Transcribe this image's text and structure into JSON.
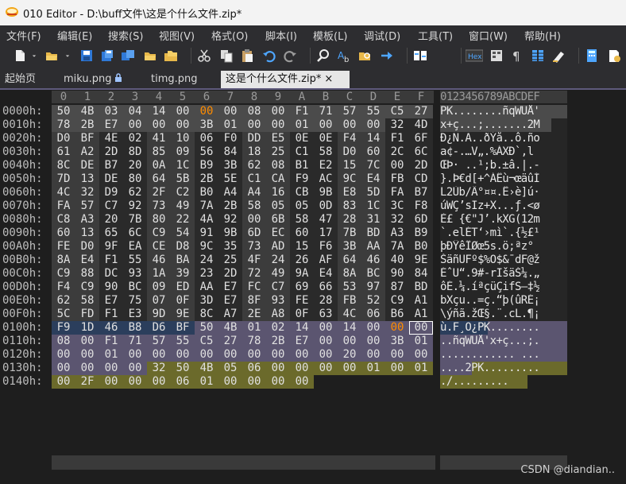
{
  "window": {
    "title": "010 Editor - D:\\buff文件\\这是个什么文件.zip*"
  },
  "menu": [
    "文件(F)",
    "编辑(E)",
    "搜索(S)",
    "视图(V)",
    "格式(O)",
    "脚本(I)",
    "模板(L)",
    "调试(D)",
    "工具(T)",
    "窗口(W)",
    "帮助(H)"
  ],
  "toolbar": {
    "icons": [
      "new-file-icon",
      "dropdown-icon",
      "open-folder-icon",
      "dropdown-icon",
      "save-icon",
      "save-as-icon",
      "save-all-icon",
      "open-folder-icon",
      "folder-group-icon",
      "cut-icon",
      "copy-icon",
      "paste-icon",
      "undo-icon",
      "redo-icon",
      "find-icon",
      "replace-icon",
      "find-in-files-icon",
      "goto-icon",
      "compare-icon",
      "hex-icon",
      "columns-icon",
      "paragraph-icon",
      "grid-icon",
      "highlight-icon",
      "calculator-icon",
      "template-icon"
    ],
    "hex_label": "Hex"
  },
  "tabs": [
    {
      "label": "起始页",
      "active": false,
      "locked": false
    },
    {
      "label": "miku.png",
      "active": false,
      "locked": true
    },
    {
      "label": "timg.png",
      "active": false,
      "locked": false
    },
    {
      "label": "这是个什么文件.zip*",
      "active": true,
      "locked": false,
      "close": "×"
    }
  ],
  "hex_view": {
    "columns": [
      "0",
      "1",
      "2",
      "3",
      "4",
      "5",
      "6",
      "7",
      "8",
      "9",
      "A",
      "B",
      "C",
      "D",
      "E",
      "F"
    ],
    "ascii_header": "0123456789ABCDEF",
    "rows": [
      {
        "addr": "0000h:",
        "bytes": [
          "50",
          "4B",
          "03",
          "04",
          "14",
          "00",
          "00",
          "00",
          "08",
          "00",
          "F1",
          "71",
          "57",
          "55",
          "C5",
          "27"
        ],
        "ascii": "PK........ñqWUÅ'"
      },
      {
        "addr": "0010h:",
        "bytes": [
          "78",
          "2B",
          "E7",
          "00",
          "00",
          "00",
          "3B",
          "01",
          "00",
          "00",
          "01",
          "00",
          "00",
          "00",
          "32",
          "4D"
        ],
        "ascii": "x+ç...;.......2M"
      },
      {
        "addr": "0020h:",
        "bytes": [
          "D0",
          "BF",
          "4E",
          "02",
          "41",
          "10",
          "06",
          "F0",
          "DD",
          "E5",
          "0E",
          "0E",
          "F4",
          "14",
          "F1",
          "6F"
        ],
        "ascii": "Ð¿N.A..ðÝå..ô.ño"
      },
      {
        "addr": "0030h:",
        "bytes": [
          "61",
          "A2",
          "2D",
          "8D",
          "85",
          "09",
          "56",
          "84",
          "18",
          "25",
          "C1",
          "58",
          "D0",
          "60",
          "2C",
          "6C"
        ],
        "ascii": "a¢-.…V„.%ÁXÐ`,l"
      },
      {
        "addr": "0040h:",
        "bytes": [
          "8C",
          "DE",
          "B7",
          "20",
          "0A",
          "1C",
          "B9",
          "3B",
          "62",
          "08",
          "B1",
          "E2",
          "15",
          "7C",
          "00",
          "2D"
        ],
        "ascii": "ŒÞ· ..¹;b.±â.|.-"
      },
      {
        "addr": "0050h:",
        "bytes": [
          "7D",
          "13",
          "DE",
          "80",
          "64",
          "5B",
          "2B",
          "5E",
          "C1",
          "CA",
          "F9",
          "AC",
          "9C",
          "E4",
          "FB",
          "CD"
        ],
        "ascii": "}.Þ€d[+^ÁÊù¬œäûÍ"
      },
      {
        "addr": "0060h:",
        "bytes": [
          "4C",
          "32",
          "D9",
          "62",
          "2F",
          "C2",
          "B0",
          "A4",
          "A4",
          "16",
          "CB",
          "9B",
          "E8",
          "5D",
          "FA",
          "B7"
        ],
        "ascii": "L2Ùb/Â°¤¤.Ë›è]ú·"
      },
      {
        "addr": "0070h:",
        "bytes": [
          "FA",
          "57",
          "C7",
          "92",
          "73",
          "49",
          "7A",
          "2B",
          "58",
          "05",
          "05",
          "0D",
          "83",
          "1C",
          "3C",
          "F8"
        ],
        "ascii": "úWÇ’sIz+X...ƒ.<ø"
      },
      {
        "addr": "0080h:",
        "bytes": [
          "C8",
          "A3",
          "20",
          "7B",
          "80",
          "22",
          "4A",
          "92",
          "00",
          "6B",
          "58",
          "47",
          "28",
          "31",
          "32",
          "6D"
        ],
        "ascii": "È£ {€\"J’.kXG(12m"
      },
      {
        "addr": "0090h:",
        "bytes": [
          "60",
          "13",
          "65",
          "6C",
          "C9",
          "54",
          "91",
          "9B",
          "6D",
          "EC",
          "60",
          "17",
          "7B",
          "BD",
          "A3",
          "B9"
        ],
        "ascii": "`.elÉT‘›mì`.{½£¹"
      },
      {
        "addr": "00A0h:",
        "bytes": [
          "FE",
          "D0",
          "9F",
          "EA",
          "CE",
          "D8",
          "9C",
          "35",
          "73",
          "AD",
          "15",
          "F6",
          "3B",
          "AA",
          "7A",
          "B0"
        ],
        "ascii": "þÐŸêÎØœ5s­.ö;ªz°"
      },
      {
        "addr": "00B0h:",
        "bytes": [
          "8A",
          "E4",
          "F1",
          "55",
          "46",
          "BA",
          "24",
          "25",
          "4F",
          "24",
          "26",
          "AF",
          "64",
          "46",
          "40",
          "9E"
        ],
        "ascii": "ŠäñUFº$%O$&¯dF@ž"
      },
      {
        "addr": "00C0h:",
        "bytes": [
          "C9",
          "88",
          "DC",
          "93",
          "1A",
          "39",
          "23",
          "2D",
          "72",
          "49",
          "9A",
          "E4",
          "8A",
          "BC",
          "90",
          "84"
        ],
        "ascii": "ÉˆÜ“.9#-rIšäŠ¼.„"
      },
      {
        "addr": "00D0h:",
        "bytes": [
          "F4",
          "C9",
          "90",
          "BC",
          "09",
          "ED",
          "AA",
          "E7",
          "FC",
          "C7",
          "69",
          "66",
          "53",
          "97",
          "87",
          "BD"
        ],
        "ascii": "ôÉ.¼.íªçüÇifS—‡½"
      },
      {
        "addr": "00E0h:",
        "bytes": [
          "62",
          "58",
          "E7",
          "75",
          "07",
          "0F",
          "3D",
          "E7",
          "8F",
          "93",
          "FE",
          "28",
          "FB",
          "52",
          "C9",
          "A1"
        ],
        "ascii": "bXçu..=ç.“þ(ûRÉ¡"
      },
      {
        "addr": "00F0h:",
        "bytes": [
          "5C",
          "FD",
          "F1",
          "E3",
          "9D",
          "9E",
          "8C",
          "A7",
          "2E",
          "A8",
          "0F",
          "63",
          "4C",
          "06",
          "B6",
          "A1"
        ],
        "ascii": "\\ýñã.žŒ§.¨.cL.¶¡"
      },
      {
        "addr": "0100h:",
        "bytes": [
          "F9",
          "1D",
          "46",
          "B8",
          "D6",
          "BF",
          "50",
          "4B",
          "01",
          "02",
          "14",
          "00",
          "14",
          "00",
          "00",
          "00"
        ],
        "ascii": "ù.F¸Ö¿PK........"
      },
      {
        "addr": "0110h:",
        "bytes": [
          "08",
          "00",
          "F1",
          "71",
          "57",
          "55",
          "C5",
          "27",
          "78",
          "2B",
          "E7",
          "00",
          "00",
          "00",
          "3B",
          "01"
        ],
        "ascii": "..ñqWUÅ'x+ç...;."
      },
      {
        "addr": "0120h:",
        "bytes": [
          "00",
          "00",
          "01",
          "00",
          "00",
          "00",
          "00",
          "00",
          "00",
          "00",
          "00",
          "00",
          "20",
          "00",
          "00",
          "00"
        ],
        "ascii": "............ ..."
      },
      {
        "addr": "0130h:",
        "bytes": [
          "00",
          "00",
          "00",
          "00",
          "32",
          "50",
          "4B",
          "05",
          "06",
          "00",
          "00",
          "00",
          "00",
          "01",
          "00",
          "01"
        ],
        "ascii": "....2PK........."
      },
      {
        "addr": "0140h:",
        "bytes": [
          "00",
          "2F",
          "00",
          "00",
          "00",
          "06",
          "01",
          "00",
          "00",
          "00",
          "00"
        ],
        "ascii": "./........."
      }
    ],
    "highlight_colors": {
      "header": "#4b4b4b",
      "data_alt_a": "#3c3c3c",
      "data_alt_b": "#2a2a2a",
      "selection_blue": "#2b3e5c",
      "central_dir": "#5b5570",
      "end_record": "#6b6a2b",
      "orange_text": "#ff8c00"
    }
  },
  "footer": {
    "watermark": "CSDN @diandian.."
  }
}
